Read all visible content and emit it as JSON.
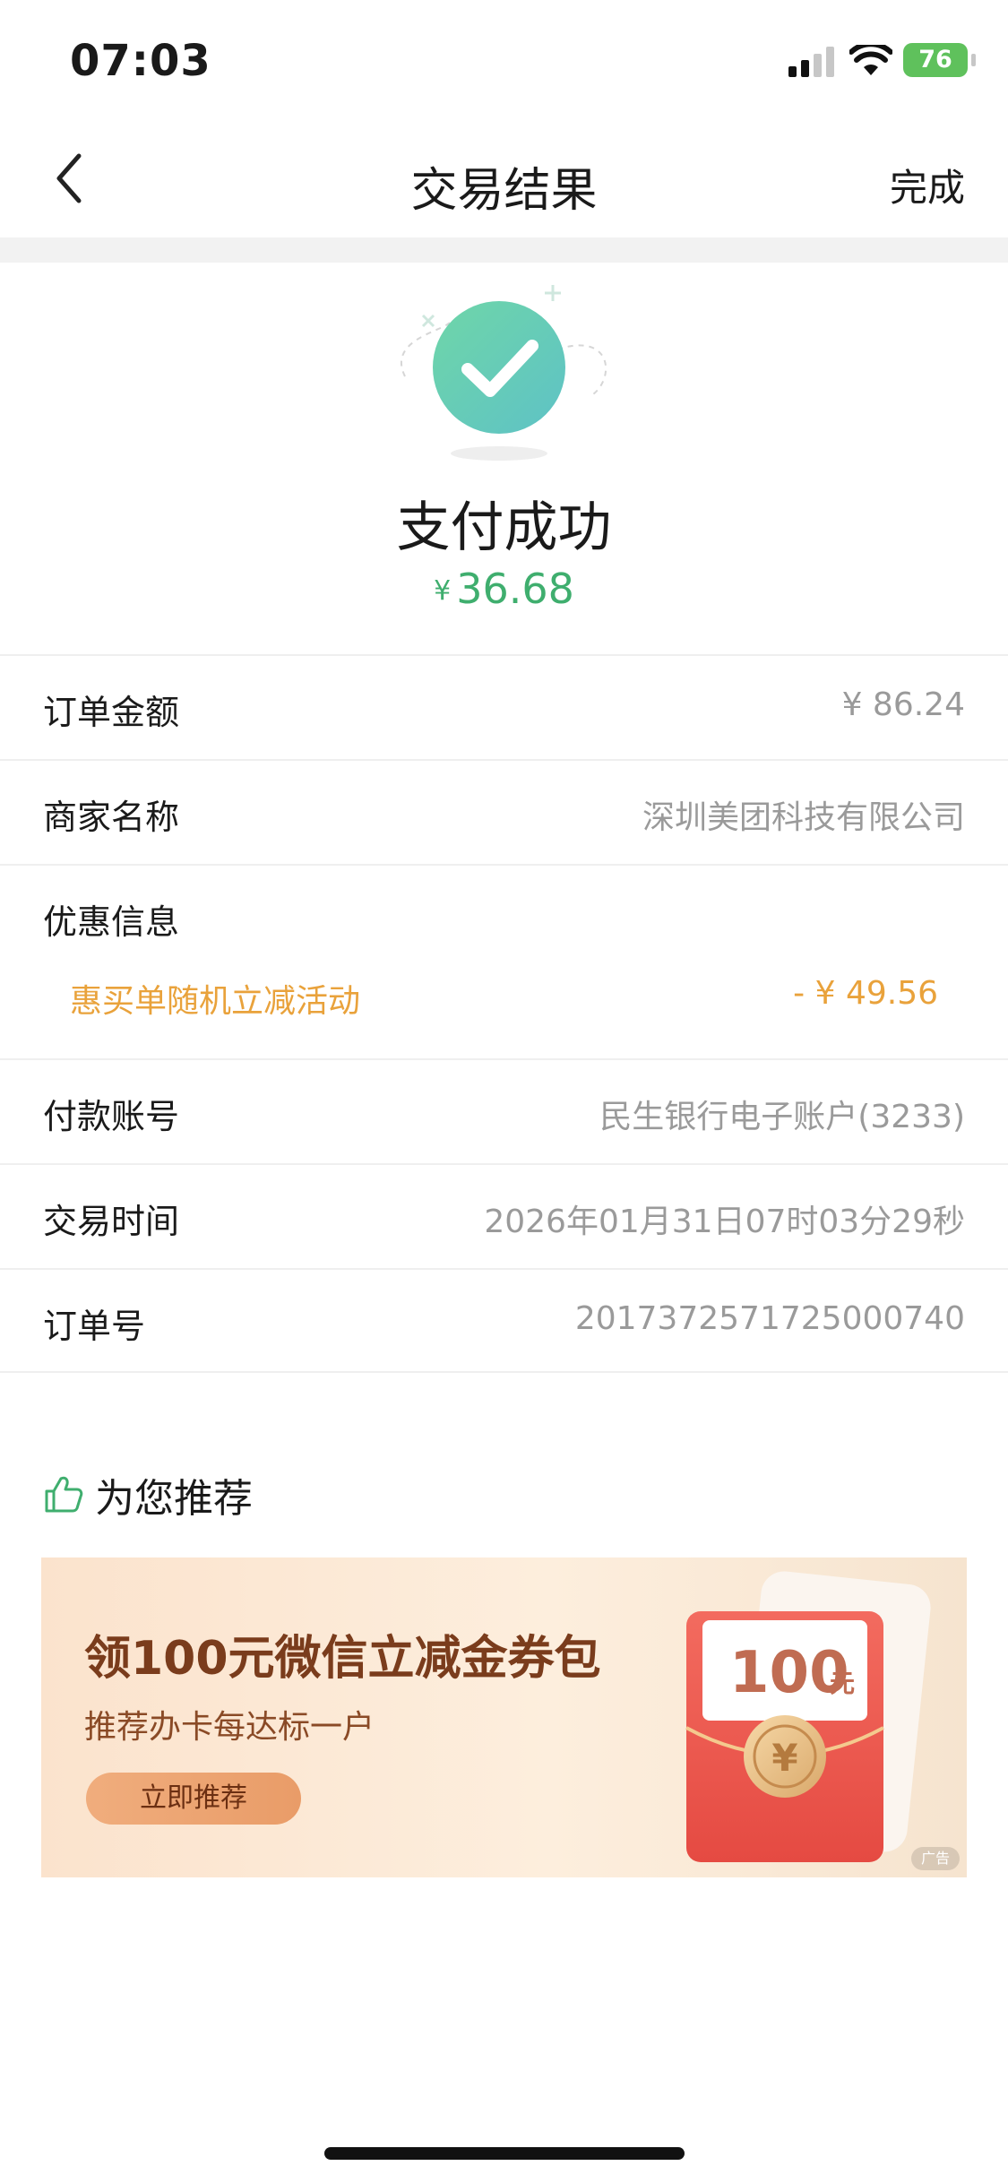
{
  "status_bar": {
    "time": "07:03",
    "battery": "76"
  },
  "nav": {
    "title": "交易结果",
    "done_label": "完成",
    "back_icon": "chevron-left-icon"
  },
  "result": {
    "title": "支付成功",
    "currency": "¥",
    "amount": "36.68",
    "icon": "checkmark-icon",
    "accent_color": "#3fae6e"
  },
  "details": {
    "order_amount": {
      "label": "订单金额",
      "value": "¥ 86.24"
    },
    "merchant": {
      "label": "商家名称",
      "value": "深圳美团科技有限公司"
    },
    "discount": {
      "label": "优惠信息",
      "promo_name": "惠买单随机立减活动",
      "promo_amount": "- ¥ 49.56",
      "promo_color": "#e9a23b"
    },
    "account": {
      "label": "付款账号",
      "value": "民生银行电子账户(3233)"
    },
    "time": {
      "label": "交易时间",
      "value": "2026年01月31日07时03分29秒"
    },
    "order_no": {
      "label": "订单号",
      "value": "2017372571725000740"
    }
  },
  "recommend": {
    "title": "为您推荐",
    "icon": "thumbs-up-icon"
  },
  "ad": {
    "title": "领100元微信立减金券包",
    "subtitle": "推荐办卡每达标一户",
    "button_label": "立即推荐",
    "coupon_amount": "100",
    "coupon_unit": "元",
    "coin_symbol": "¥",
    "badge": "广告"
  }
}
